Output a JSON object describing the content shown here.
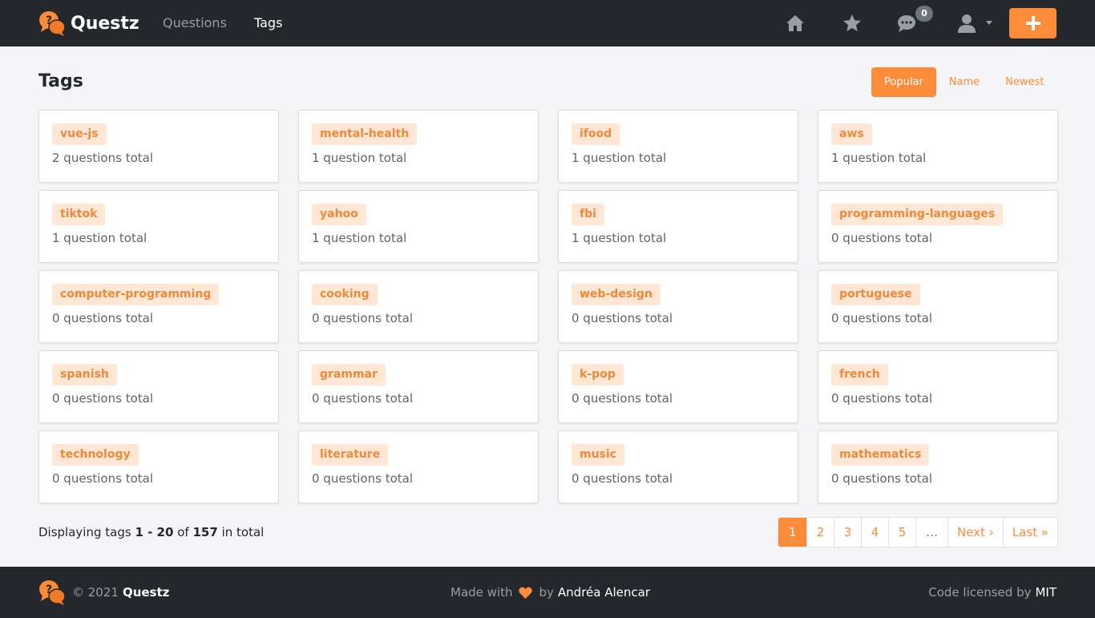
{
  "navbar": {
    "brand": "Questz",
    "links": [
      "Questions",
      "Tags"
    ],
    "icons": [
      "home-icon",
      "star-icon",
      "comments-icon",
      "user-icon"
    ],
    "messages_badge": "0",
    "add_icon": "plus-icon"
  },
  "header": {
    "title": "Tags",
    "sort_options": [
      "Popular",
      "Name",
      "Newest"
    ],
    "active_sort": "Popular"
  },
  "tags": [
    {
      "name": "vue-js",
      "count": "2 questions total"
    },
    {
      "name": "mental-health",
      "count": "1 question total"
    },
    {
      "name": "ifood",
      "count": "1 question total"
    },
    {
      "name": "aws",
      "count": "1 question total"
    },
    {
      "name": "tiktok",
      "count": "1 question total"
    },
    {
      "name": "yahoo",
      "count": "1 question total"
    },
    {
      "name": "fbi",
      "count": "1 question total"
    },
    {
      "name": "programming-languages",
      "count": "0 questions total"
    },
    {
      "name": "computer-programming",
      "count": "0 questions total"
    },
    {
      "name": "cooking",
      "count": "0 questions total"
    },
    {
      "name": "web-design",
      "count": "0 questions total"
    },
    {
      "name": "portuguese",
      "count": "0 questions total"
    },
    {
      "name": "spanish",
      "count": "0 questions total"
    },
    {
      "name": "grammar",
      "count": "0 questions total"
    },
    {
      "name": "k-pop",
      "count": "0 questions total"
    },
    {
      "name": "french",
      "count": "0 questions total"
    },
    {
      "name": "technology",
      "count": "0 questions total"
    },
    {
      "name": "literature",
      "count": "0 questions total"
    },
    {
      "name": "music",
      "count": "0 questions total"
    },
    {
      "name": "mathematics",
      "count": "0 questions total"
    }
  ],
  "summary": {
    "prefix": "Displaying tags",
    "range": "1 - 20",
    "of": "of",
    "total": "157",
    "suffix": "in total"
  },
  "pagination": {
    "pages": [
      "1",
      "2",
      "3",
      "4",
      "5"
    ],
    "active": "1",
    "ellipsis": "…",
    "next": "Next ›",
    "last": "Last »"
  },
  "footer": {
    "copyright": "© 2021",
    "brand": "Questz",
    "made_with": "Made with",
    "by": "by",
    "author": "Andréa Alencar",
    "license_text": "Code licensed by",
    "license": "MIT"
  },
  "colors": {
    "accent": "#fd8c3a",
    "navbar_bg": "#24272b",
    "tag_bg": "#ffe6d5",
    "page_bg": "#f5f5f7"
  }
}
